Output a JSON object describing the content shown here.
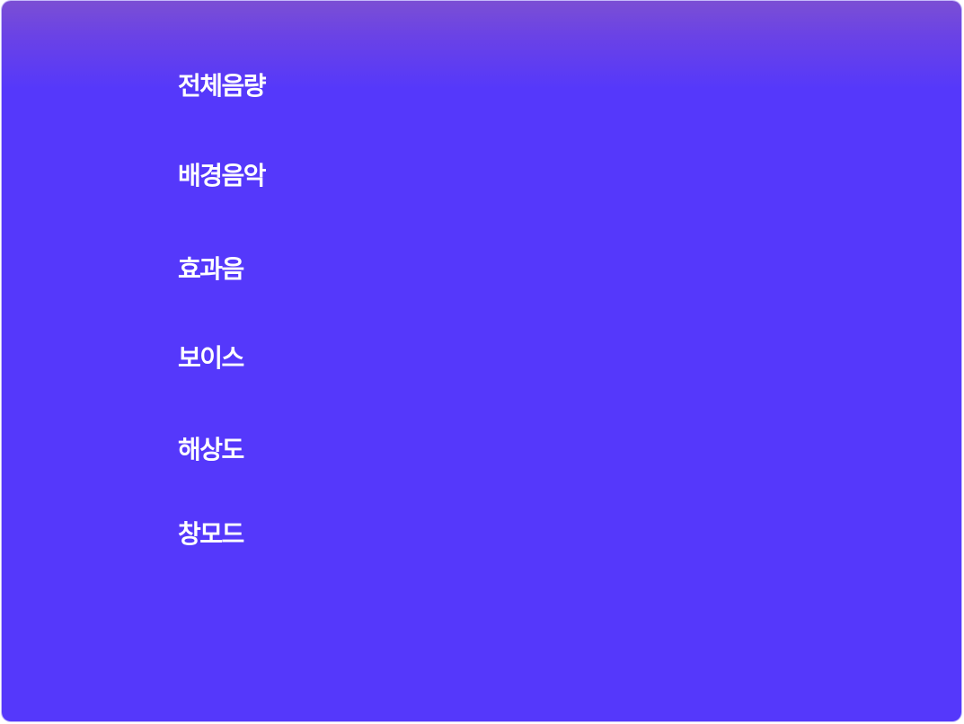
{
  "settings": {
    "items": [
      {
        "label": "전체음량"
      },
      {
        "label": "배경음악"
      },
      {
        "label": "효과음"
      },
      {
        "label": "보이스"
      },
      {
        "label": "해상도"
      },
      {
        "label": "창모드"
      }
    ]
  },
  "colors": {
    "panel_top": "#7b4fd4",
    "panel_main": "#5538fb",
    "text": "#ffffff"
  }
}
